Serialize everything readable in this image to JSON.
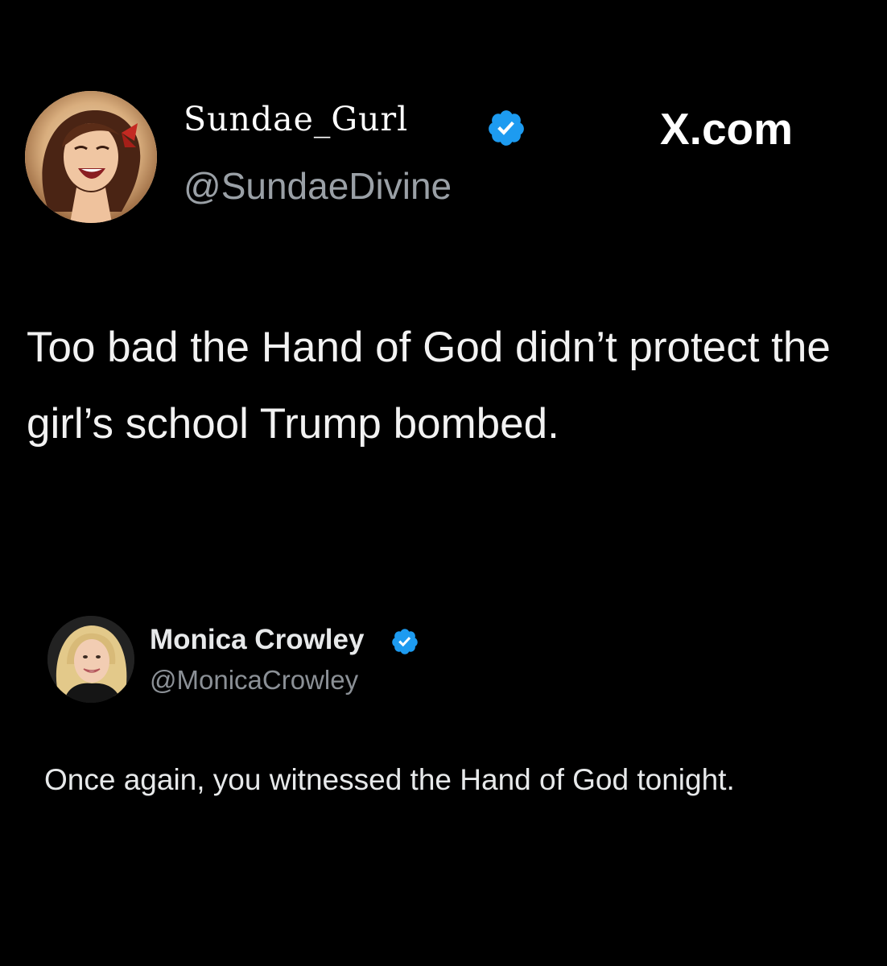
{
  "main_post": {
    "display_name": "Sundae_Gurl",
    "handle": "@SundaeDivine",
    "verified_icon": "verified-badge-icon",
    "text": "Too bad the Hand of God didn’t protect the girl’s school Trump bombed."
  },
  "branding": {
    "site": "X.com"
  },
  "quoted_post": {
    "display_name": "Monica Crowley",
    "handle": "@MonicaCrowley",
    "verified_icon": "verified-badge-icon",
    "text": "Once again, you witnessed the Hand of God tonight."
  },
  "colors": {
    "background": "#000000",
    "text_primary": "#ffffff",
    "text_secondary": "#9aa0a6",
    "verified_blue": "#1d9bf0"
  }
}
